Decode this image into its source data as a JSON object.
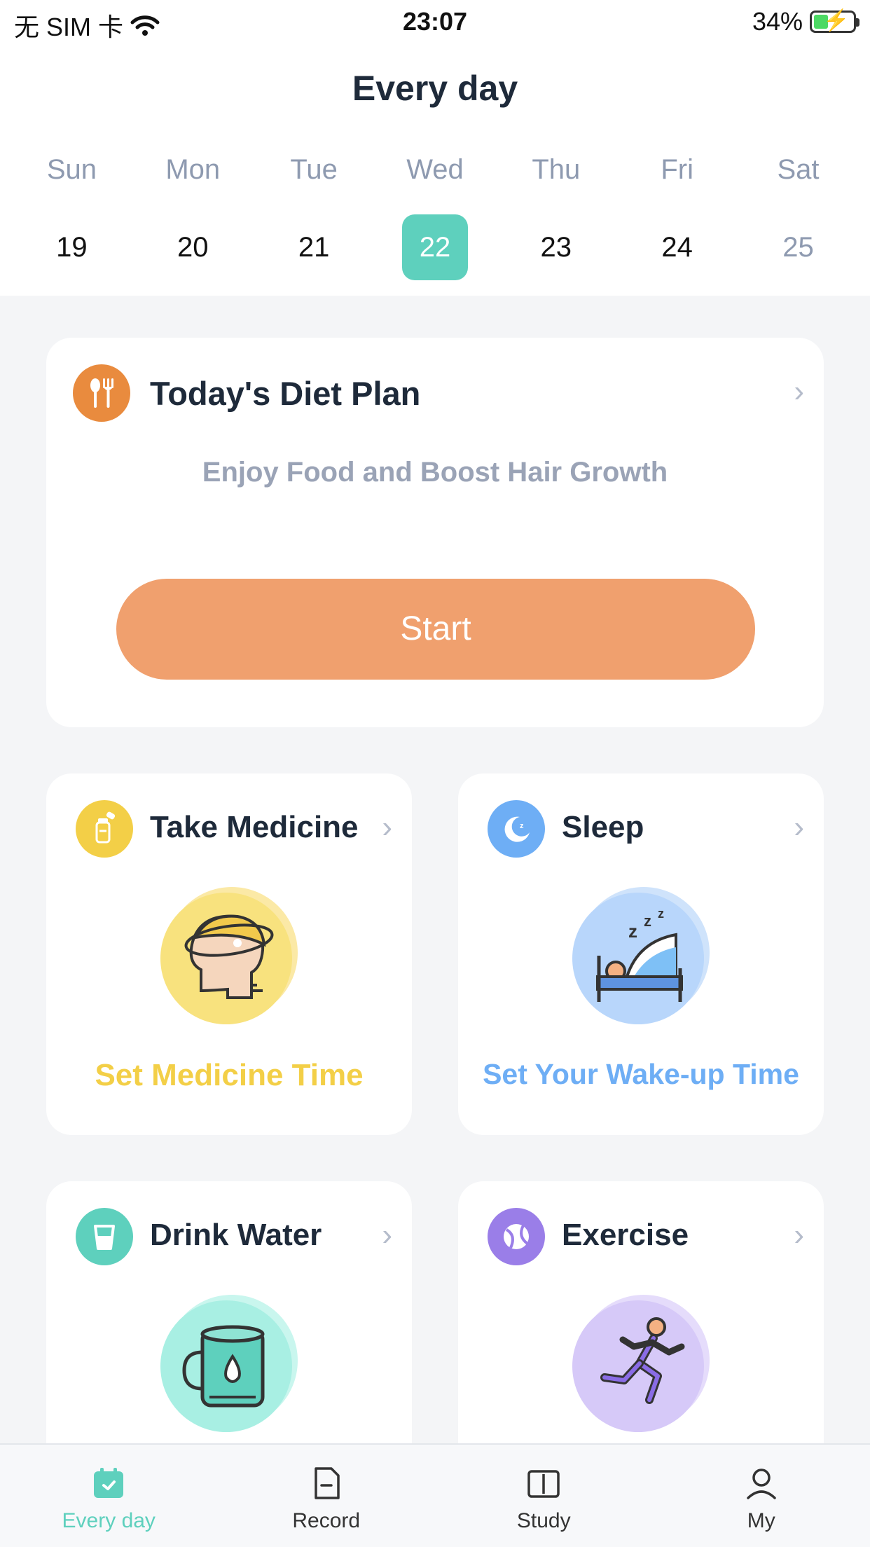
{
  "status_bar": {
    "carrier": "无 SIM 卡",
    "time": "23:07",
    "battery": "34%"
  },
  "header": {
    "title": "Every day",
    "days": [
      {
        "name": "Sun",
        "num": "19"
      },
      {
        "name": "Mon",
        "num": "20"
      },
      {
        "name": "Tue",
        "num": "21"
      },
      {
        "name": "Wed",
        "num": "22"
      },
      {
        "name": "Thu",
        "num": "23"
      },
      {
        "name": "Fri",
        "num": "24"
      },
      {
        "name": "Sat",
        "num": "25"
      }
    ],
    "selected_day": "22"
  },
  "diet_card": {
    "title": "Today's Diet Plan",
    "subtitle": "Enjoy Food and Boost Hair Growth",
    "button": "Start",
    "icon": "fork-knife-icon",
    "accent": "#e98b3e"
  },
  "cards": {
    "medicine": {
      "title": "Take Medicine",
      "action": "Set Medicine Time",
      "icon": "pill-bottle-icon",
      "accent": "#f3cf47"
    },
    "sleep": {
      "title": "Sleep",
      "action": "Set Your Wake-up Time",
      "icon": "moon-icon",
      "accent": "#6eaef5"
    },
    "water": {
      "title": "Drink Water",
      "icon": "cup-icon",
      "accent": "#5ed0bd"
    },
    "exercise": {
      "title": "Exercise",
      "icon": "ball-icon",
      "accent": "#9a7ee8"
    }
  },
  "tabbar": {
    "tabs": [
      {
        "label": "Every day",
        "icon": "calendar-icon",
        "active": true
      },
      {
        "label": "Record",
        "icon": "document-icon",
        "active": false
      },
      {
        "label": "Study",
        "icon": "book-icon",
        "active": false
      },
      {
        "label": "My",
        "icon": "person-icon",
        "active": false
      }
    ]
  },
  "colors": {
    "primary": "#5ed0bd",
    "start_button": "#f0a06e"
  }
}
